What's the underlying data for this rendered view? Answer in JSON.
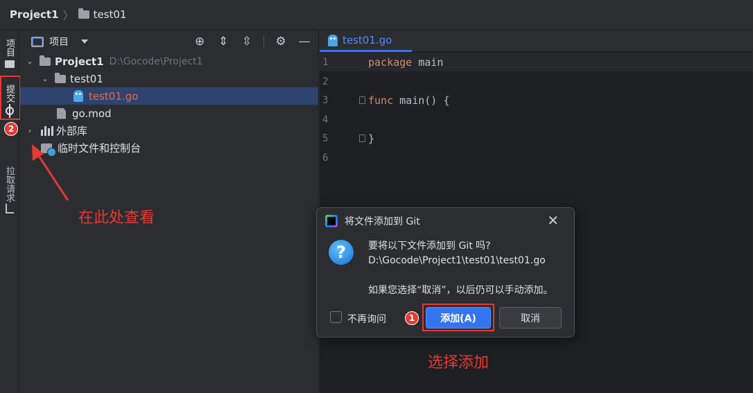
{
  "breadcrumb": {
    "project": "Project1",
    "folder": "test01"
  },
  "toolstrip": {
    "project_label": "项目",
    "commit_label": "提交",
    "pull_label": "拉取请求",
    "badge_2": "2"
  },
  "panel": {
    "title": "项目",
    "tree": [
      {
        "label": "Project1",
        "path": "D:\\Gocode\\Project1"
      },
      {
        "label": "test01"
      },
      {
        "label": "test01.go"
      },
      {
        "label": "go.mod"
      },
      {
        "label": "外部库"
      },
      {
        "label": "临时文件和控制台"
      }
    ]
  },
  "editor": {
    "tab": "test01.go",
    "lines": [
      {
        "no": "1",
        "kw": "package",
        "rest": " main"
      },
      {
        "no": "2",
        "kw": "",
        "rest": ""
      },
      {
        "no": "3",
        "kw": "func",
        "rest": " main() {"
      },
      {
        "no": "4",
        "kw": "",
        "rest": ""
      },
      {
        "no": "5",
        "kw": "",
        "rest": "}"
      },
      {
        "no": "6",
        "kw": "",
        "rest": ""
      }
    ]
  },
  "dialog": {
    "title": "将文件添加到 Git",
    "question": "要将以下文件添加到 Git 吗?",
    "file": "D:\\Gocode\\Project1\\test01\\test01.go",
    "note": "如果您选择“取消”，以后仍可以手动添加。",
    "dont_ask": "不再询问",
    "add": "添加(A)",
    "cancel": "取消",
    "badge_1": "1"
  },
  "annotations": {
    "view_here": "在此处查看",
    "select_add": "选择添加"
  },
  "colors": {
    "annotation_red": "#e53935",
    "accent_blue": "#3574f0",
    "selection": "#2e436e"
  }
}
